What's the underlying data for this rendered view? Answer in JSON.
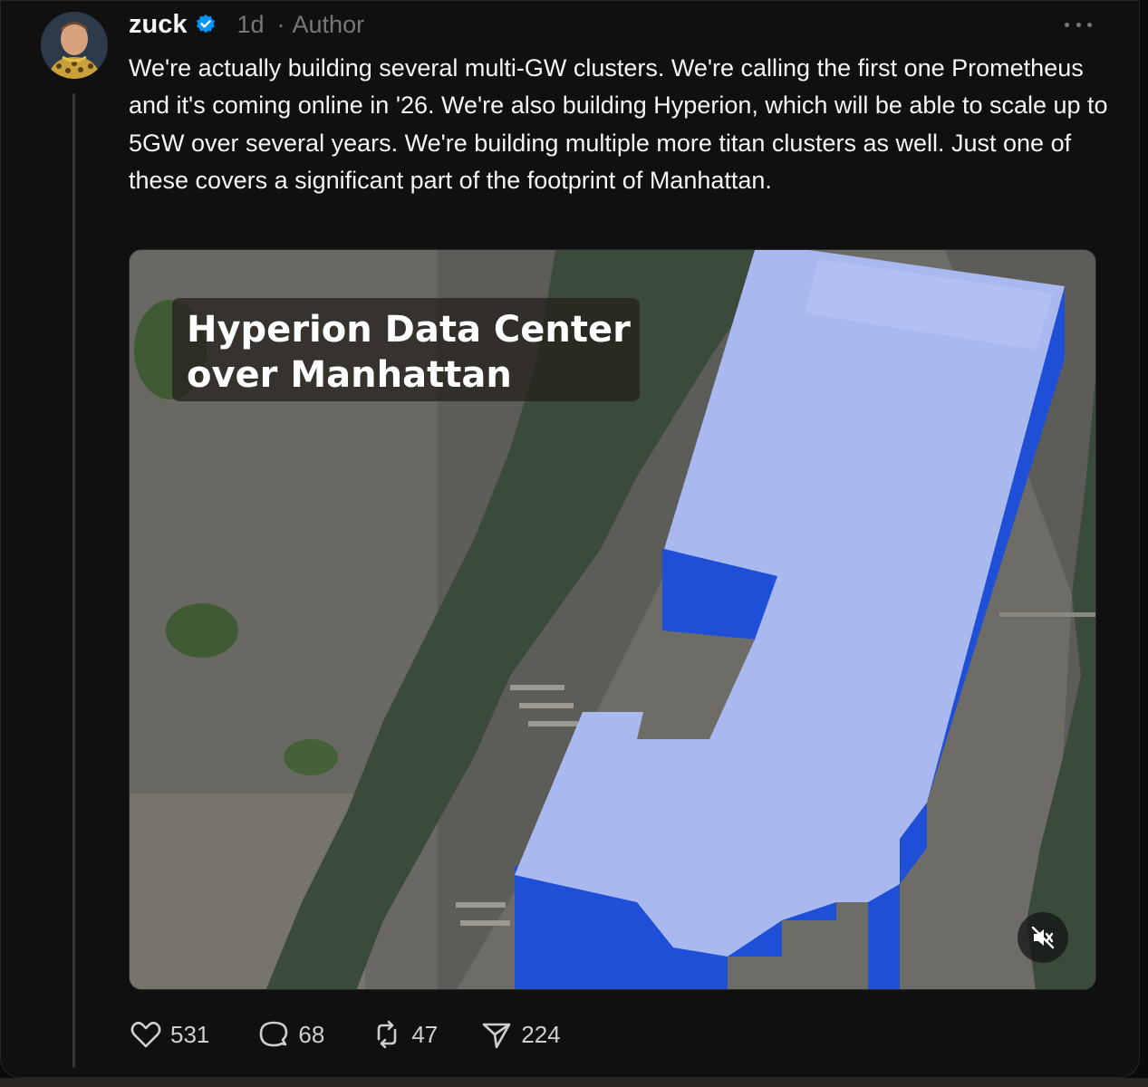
{
  "post": {
    "username": "zuck",
    "time": "1d",
    "separator": "·",
    "author_label": "Author",
    "text": "We're actually building several multi-GW clusters. We're calling the first one Prometheus and it's coming online in '26. We're also building Hyperion, which will be able to scale up to 5GW over several years. We're building multiple more titan clusters as well. Just one of these covers a significant part of the footprint of Manhattan."
  },
  "media": {
    "title_line1": "Hyperion Data Center",
    "title_line2": "over Manhattan",
    "mute_icon": "speaker-muted-icon"
  },
  "actions": {
    "likes": "531",
    "replies": "68",
    "reposts": "47",
    "shares": "224"
  },
  "colors": {
    "background": "#101010",
    "text": "#f3f5f7",
    "muted": "#777777",
    "verified": "#0095f6",
    "building_top": "#aab9f0",
    "building_side": "#1f4fd8"
  }
}
